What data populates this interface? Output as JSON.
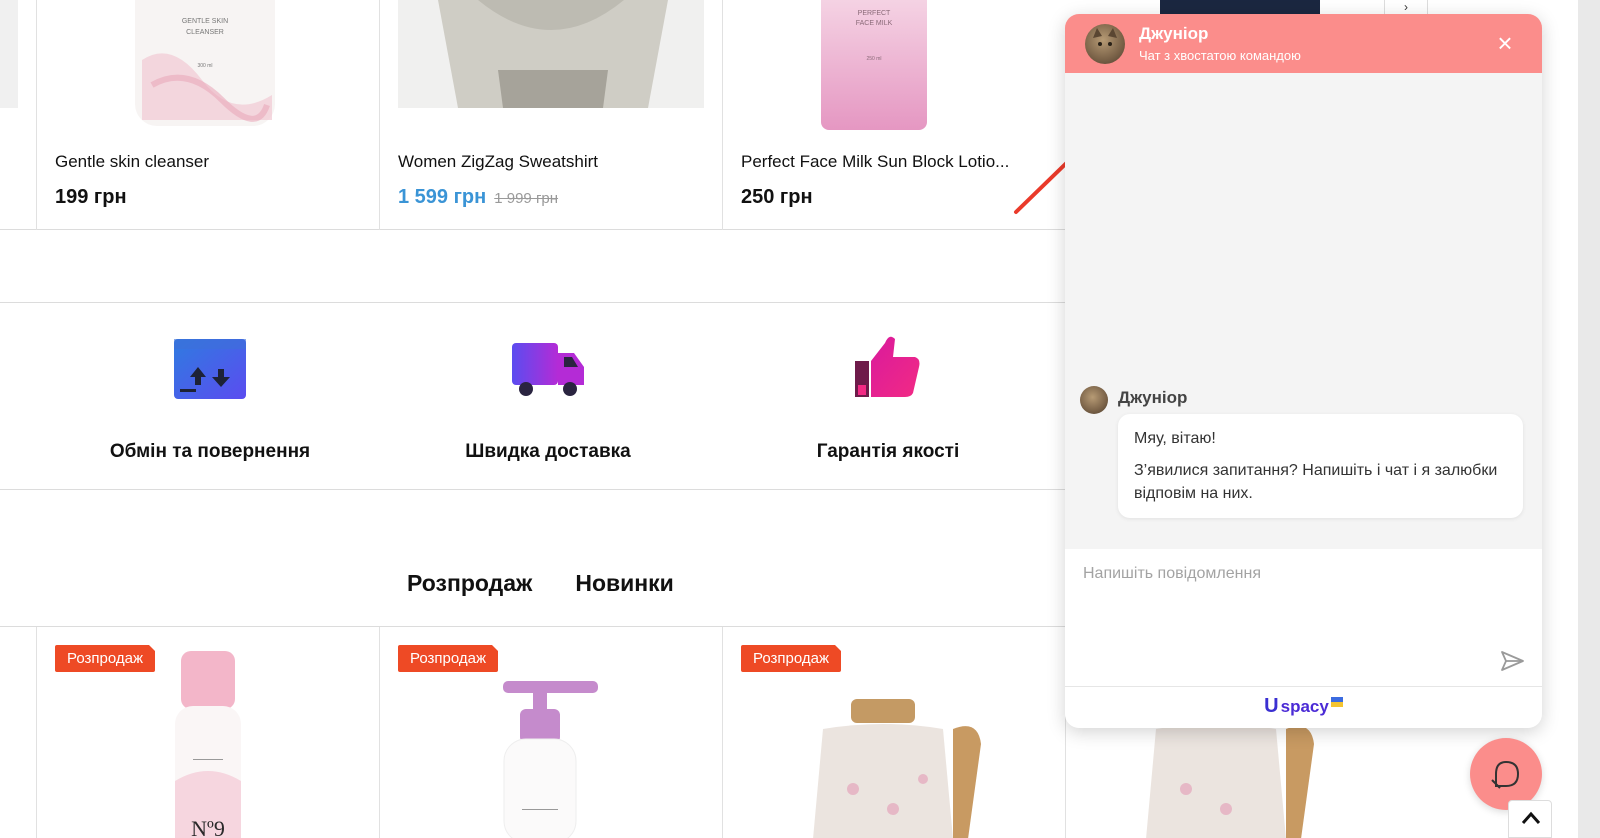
{
  "top_products": [
    {
      "name": "Gentle skin cleanser",
      "price": "199 грн",
      "img_text": [
        "GENTLE SKIN",
        "CLEANSER",
        "300 ml"
      ]
    },
    {
      "name": "Women ZigZag Sweatshirt",
      "price": "1 599 грн",
      "old_price": "1 999 грн"
    },
    {
      "name": "Perfect Face Milk Sun Block Lotio...",
      "price": "250 грн",
      "img_text": [
        "PERFECT",
        "FACE MILK",
        "250 ml"
      ]
    }
  ],
  "features": [
    {
      "label": "Обмін та повернення",
      "icon": "exchange-icon"
    },
    {
      "label": "Швидка доставка",
      "icon": "truck-icon"
    },
    {
      "label": "Гарантія якості",
      "icon": "thumbs-up-icon"
    }
  ],
  "tabs": [
    "Розпродаж",
    "Новинки"
  ],
  "bottom_products": [
    {
      "badge": "Розпродаж"
    },
    {
      "badge": "Розпродаж"
    },
    {
      "badge": "Розпродаж"
    },
    {}
  ],
  "chat": {
    "title": "Джуніор",
    "subtitle": "Чат з хвостатою командою",
    "close_icon": "×",
    "message_author": "Джуніор",
    "message_line1": "Мяу, вітаю!",
    "message_line2": "З’явилися запитання? Напишіть і чат і я залюбки відповім на них.",
    "input_placeholder": "Напишіть повідомлення",
    "brand": "spacy",
    "brand_u": "U"
  },
  "colors": {
    "chat_header": "#fb8d8b",
    "badge": "#ee4a25",
    "sale_price": "#3a94d6",
    "arrow": "#ea3a2a"
  }
}
